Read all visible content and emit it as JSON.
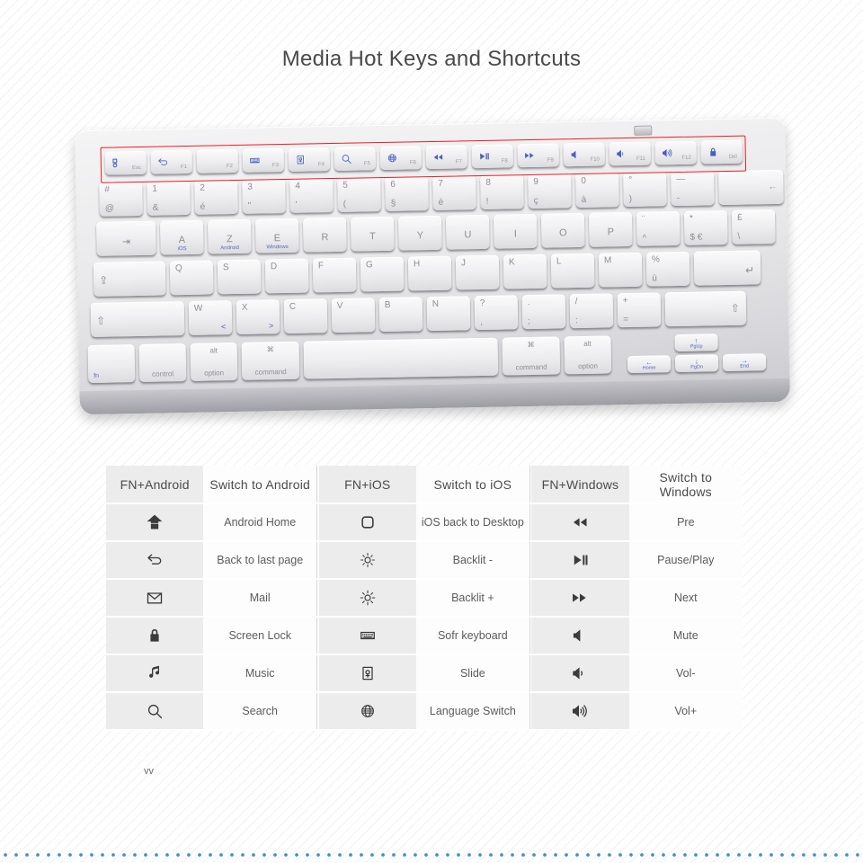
{
  "page": {
    "title": "Media Hot Keys and Shortcuts",
    "note": "vv"
  },
  "keyboard": {
    "fn_row": [
      {
        "label": "Esc",
        "icon": "screen-shot-icon"
      },
      {
        "label": "F1",
        "icon": "back-arrow-icon"
      },
      {
        "label": "F2",
        "icon": "brightness-icon"
      },
      {
        "label": "F3",
        "icon": "soft-keyboard-icon"
      },
      {
        "label": "F4",
        "icon": "slide-icon"
      },
      {
        "label": "F5",
        "icon": "search-icon"
      },
      {
        "label": "F6",
        "icon": "globe-icon"
      },
      {
        "label": "F7",
        "icon": "rewind-icon"
      },
      {
        "label": "F8",
        "icon": "play-pause-icon"
      },
      {
        "label": "F9",
        "icon": "fast-forward-icon"
      },
      {
        "label": "F10",
        "icon": "mute-icon"
      },
      {
        "label": "F11",
        "icon": "volume-down-icon"
      },
      {
        "label": "F12",
        "icon": "volume-up-icon"
      },
      {
        "label": "Del",
        "icon": "lock-icon"
      }
    ],
    "number_row": [
      {
        "top": "#",
        "bottom": "@"
      },
      {
        "top": "1",
        "bottom": "&"
      },
      {
        "top": "2",
        "bottom": "é"
      },
      {
        "top": "3",
        "bottom": "\""
      },
      {
        "top": "4",
        "bottom": "'"
      },
      {
        "top": "5",
        "bottom": "("
      },
      {
        "top": "6",
        "bottom": "§"
      },
      {
        "top": "7",
        "bottom": "è"
      },
      {
        "top": "8",
        "bottom": "!"
      },
      {
        "top": "9",
        "bottom": "ç"
      },
      {
        "top": "0",
        "bottom": "à"
      },
      {
        "top": "°",
        "bottom": ")"
      },
      {
        "top": "—",
        "bottom": "-"
      },
      {
        "top": "",
        "bottom": "",
        "center": "←",
        "name": "backspace-key"
      }
    ],
    "row_azerty": [
      {
        "center": "⇥",
        "name": "tab-key"
      },
      {
        "center": "A",
        "sub": "iOS"
      },
      {
        "center": "Z",
        "sub": "Android"
      },
      {
        "center": "E",
        "sub": "Windows"
      },
      {
        "center": "R"
      },
      {
        "center": "T"
      },
      {
        "center": "Y"
      },
      {
        "center": "U"
      },
      {
        "center": "I"
      },
      {
        "center": "O"
      },
      {
        "center": "P"
      },
      {
        "top": "¨",
        "bottom": "^"
      },
      {
        "top": "*",
        "bottom": "$ €"
      },
      {
        "top": "£",
        "bottom": "\\"
      }
    ],
    "row_home": [
      {
        "center": "⇪",
        "name": "caps-lock-key"
      },
      {
        "center": "Q"
      },
      {
        "center": "S"
      },
      {
        "center": "D"
      },
      {
        "center": "F"
      },
      {
        "center": "G"
      },
      {
        "center": "H"
      },
      {
        "center": "J"
      },
      {
        "center": "K"
      },
      {
        "center": "L"
      },
      {
        "center": "M"
      },
      {
        "top": "%",
        "bottom": "ù"
      },
      {
        "center": "↵",
        "name": "enter-key"
      }
    ],
    "row_shift": [
      {
        "center": "⇧",
        "name": "left-shift-key"
      },
      {
        "center": "W",
        "corner": "<"
      },
      {
        "center": "X",
        "corner": ">"
      },
      {
        "center": "C"
      },
      {
        "center": "V"
      },
      {
        "center": "B"
      },
      {
        "center": "N"
      },
      {
        "top": "?",
        "bottom": ","
      },
      {
        "top": ".",
        "bottom": ";"
      },
      {
        "top": "/",
        "bottom": ":"
      },
      {
        "top": "+",
        "bottom": "="
      },
      {
        "center": "⇧",
        "name": "right-shift-key"
      }
    ],
    "row_bottom": [
      {
        "label": "fn",
        "name": "fn-key"
      },
      {
        "label": "control",
        "name": "control-key"
      },
      {
        "top": "alt",
        "bottom": "option",
        "name": "left-alt-option-key"
      },
      {
        "top": "⌘",
        "bottom": "command",
        "name": "left-command-key"
      },
      {
        "label": "",
        "name": "space-key"
      },
      {
        "top": "⌘",
        "bottom": "command",
        "name": "right-command-key"
      },
      {
        "top": "alt",
        "bottom": "option",
        "name": "right-alt-option-key"
      }
    ],
    "arrows": [
      {
        "glyph": "←",
        "label": "Home",
        "name": "left-arrow-key"
      },
      {
        "glyph": "↑",
        "label": "PgUp",
        "name": "up-arrow-key"
      },
      {
        "glyph": "↓",
        "label": "PgDn",
        "name": "down-arrow-key"
      },
      {
        "glyph": "→",
        "label": "End",
        "name": "right-arrow-key"
      }
    ],
    "highlight_color": "#ee1b24"
  },
  "table": {
    "headers": {
      "android_combo": "FN+Android",
      "android_action": "Switch to Android",
      "ios_combo": "FN+iOS",
      "ios_action": "Switch to iOS",
      "windows_combo": "FN+Windows",
      "windows_action": "Switch to Windows"
    },
    "rows": [
      {
        "android_icon": "home-arrow-icon",
        "android_label": "Android Home",
        "ios_icon": "rounded-square-icon",
        "ios_label": "iOS back to Desktop",
        "win_icon": "rewind-icon",
        "win_label": "Pre"
      },
      {
        "android_icon": "back-arrow-icon",
        "android_label": "Back to last page",
        "ios_icon": "brightness-down-icon",
        "ios_label": "Backlit -",
        "win_icon": "play-pause-icon",
        "win_label": "Pause/Play"
      },
      {
        "android_icon": "envelope-icon",
        "android_label": "Mail",
        "ios_icon": "brightness-up-icon",
        "ios_label": "Backlit +",
        "win_icon": "fast-forward-icon",
        "win_label": "Next"
      },
      {
        "android_icon": "lock-icon",
        "android_label": "Screen Lock",
        "ios_icon": "soft-keyboard-icon",
        "ios_label": "Sofr keyboard",
        "win_icon": "mute-icon",
        "win_label": "Mute"
      },
      {
        "android_icon": "music-note-icon",
        "android_label": "Music",
        "ios_icon": "slide-icon",
        "ios_label": "Slide",
        "win_icon": "volume-down-icon",
        "win_label": "Vol-"
      },
      {
        "android_icon": "search-icon",
        "android_label": "Search",
        "ios_icon": "globe-icon",
        "ios_label": "Language Switch",
        "win_icon": "volume-up-icon",
        "win_label": "Vol+"
      }
    ]
  }
}
